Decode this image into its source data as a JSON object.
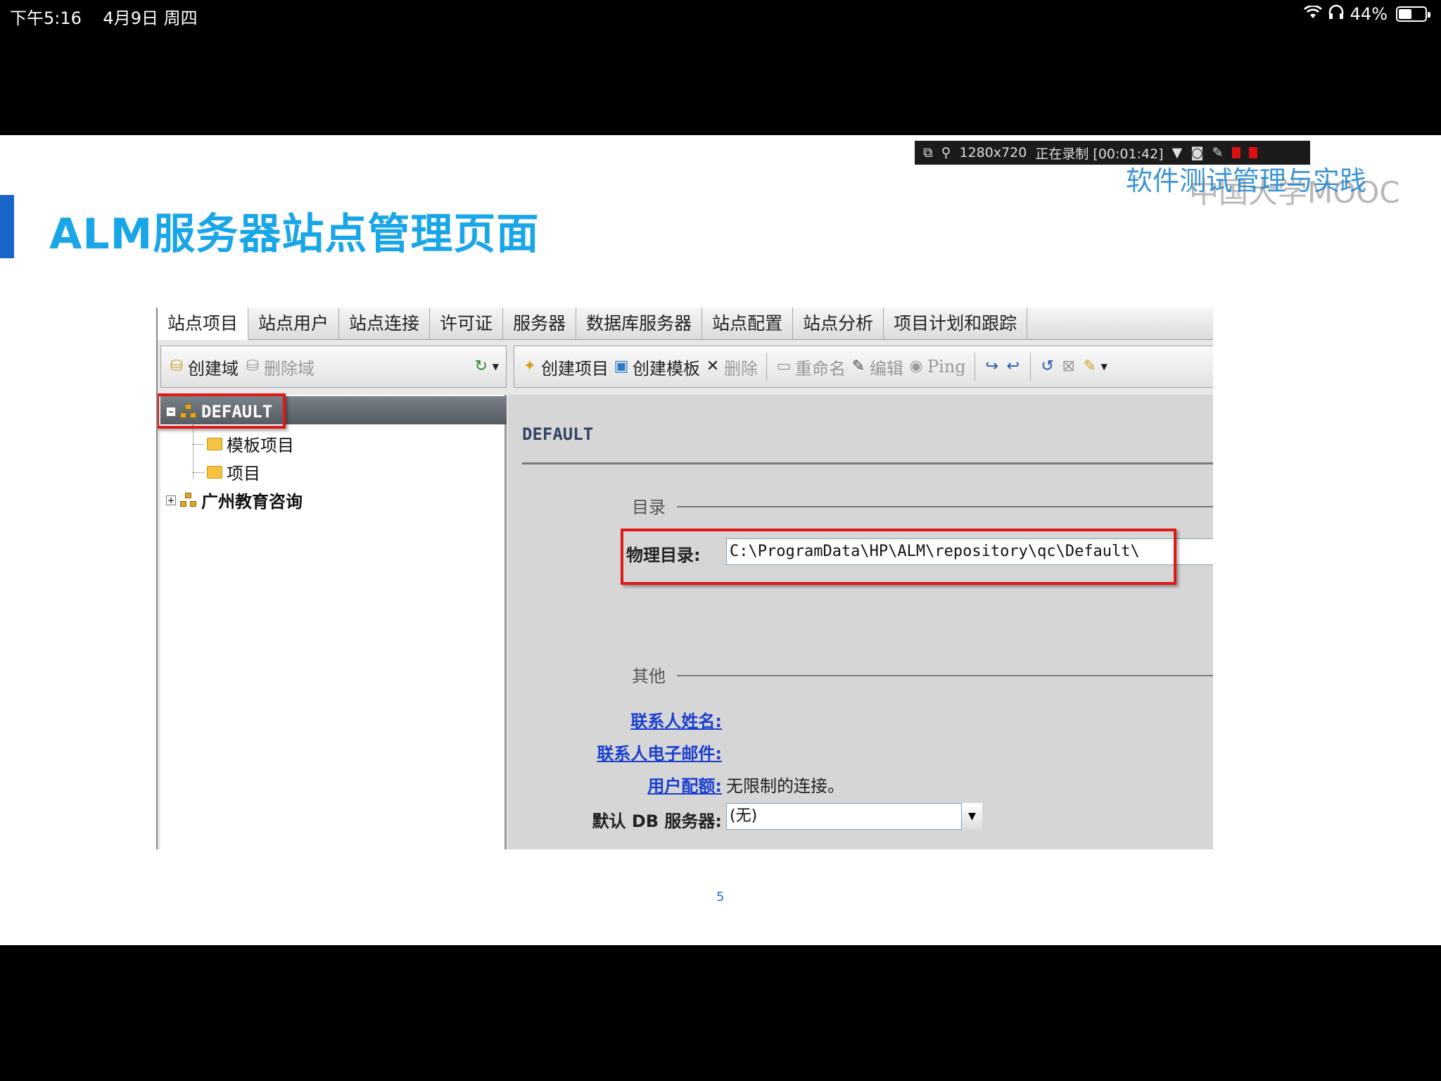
{
  "statusbar": {
    "time": "下午5:16",
    "date": "4月9日 周四",
    "battery": "44%"
  },
  "recorder": {
    "resolution": "1280x720",
    "status": "正在录制 [00:01:42]"
  },
  "watermark": {
    "course": "软件测试管理与实践",
    "platform": "中国大学MOOC"
  },
  "slide": {
    "title": "ALM服务器站点管理页面",
    "page_number": "5"
  },
  "tabs": [
    "站点项目",
    "站点用户",
    "站点连接",
    "许可证",
    "服务器",
    "数据库服务器",
    "站点配置",
    "站点分析",
    "项目计划和跟踪"
  ],
  "left_toolbar": {
    "create_domain": "创建域",
    "delete_domain": "删除域"
  },
  "right_toolbar": {
    "create_project": "创建项目",
    "create_template": "创建模板",
    "delete": "删除",
    "rename": "重命名",
    "edit": "编辑",
    "ping": "Ping"
  },
  "tree": {
    "default_domain": "DEFAULT",
    "template_projects": "模板项目",
    "projects": "项目",
    "other_domain": "广州教育咨询"
  },
  "detail": {
    "header": "DEFAULT",
    "section_directory": "目录",
    "physical_dir_label": "物理目录:",
    "physical_dir_value": "C:\\ProgramData\\HP\\ALM\\repository\\qc\\Default\\",
    "section_other": "其他",
    "contact_name_label": "联系人姓名:",
    "contact_email_label": "联系人电子邮件:",
    "user_quota_label": "用户配额:",
    "user_quota_value": "无限制的连接。",
    "default_db_label": "默认 DB 服务器:",
    "default_db_value": "(无)"
  }
}
